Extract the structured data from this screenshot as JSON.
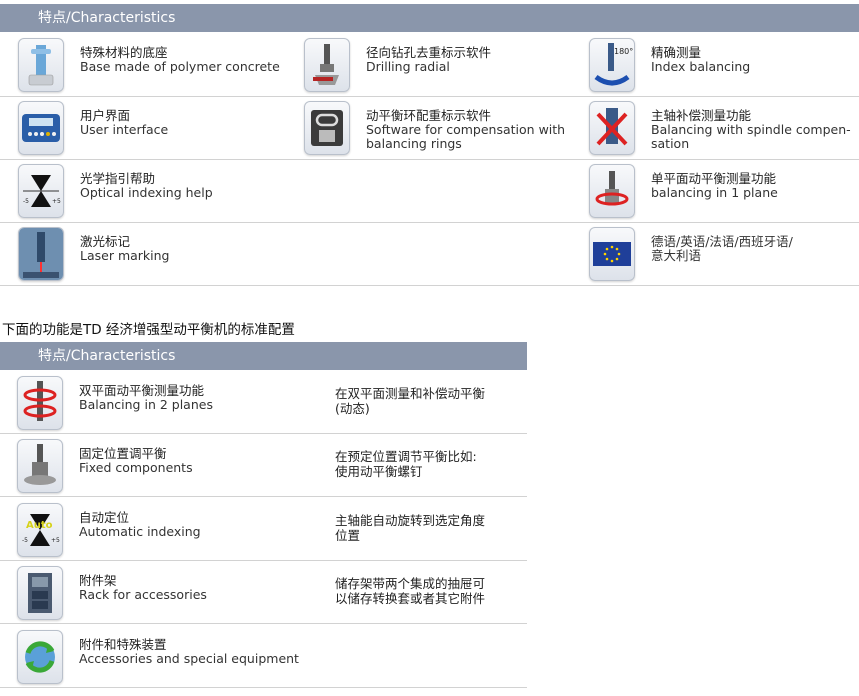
{
  "sections": [
    {
      "header": "特点/Characteristics",
      "items": [
        {
          "icon": "machine-base-icon",
          "cn": "特殊材料的底座",
          "en": [
            "Base made of polymer concrete"
          ]
        },
        {
          "icon": "drill-spindle-icon",
          "cn": "径向钻孔去重标示软件",
          "en": [
            "Drilling radial"
          ]
        },
        {
          "icon": "index-180-icon",
          "cn": "精确测量",
          "en": [
            "Index balancing"
          ]
        },
        {
          "icon": "control-panel-icon",
          "cn": "用户界面",
          "en": [
            "User interface"
          ]
        },
        {
          "icon": "balancing-ring-icon",
          "cn": "动平衡环配重标示软件",
          "en": [
            "Software for compensation with",
            "balancing rings"
          ]
        },
        {
          "icon": "spindle-crossed-icon",
          "cn": "主轴补偿测量功能",
          "en": [
            "Balancing with spindle compen-",
            "sation"
          ]
        },
        {
          "icon": "optical-index-icon",
          "cn": "光学指引帮助",
          "en": [
            "Optical indexing help"
          ]
        },
        {
          "icon": "single-plane-icon",
          "cn": "单平面动平衡测量功能",
          "en": [
            "balancing in 1 plane"
          ]
        },
        {
          "icon": "laser-marking-icon",
          "cn": "激光标记",
          "en": [
            "Laser marking"
          ]
        },
        {
          "icon": "eu-flag-icon",
          "cn": "德语/英语/法语/西班牙语/",
          "en": [
            "意大利语"
          ]
        }
      ]
    },
    {
      "title": "下面的功能是TD 经济增强型动平衡机的标准配置",
      "header": "特点/Characteristics",
      "items": [
        {
          "icon": "two-plane-icon",
          "cn": "双平面动平衡测量功能",
          "en": [
            "Balancing in 2 planes"
          ],
          "desc": [
            "在双平面测量和补偿动平衡",
            "(动态)"
          ]
        },
        {
          "icon": "fixed-component-icon",
          "cn": "固定位置调平衡",
          "en": [
            "Fixed components"
          ],
          "desc": [
            "在预定位置调节平衡比如:",
            "使用动平衡螺钉"
          ]
        },
        {
          "icon": "auto-index-icon",
          "cn": "自动定位",
          "en": [
            "Automatic indexing"
          ],
          "desc": [
            "主轴能自动旋转到选定角度",
            "位置"
          ],
          "badge": "Auto"
        },
        {
          "icon": "rack-icon",
          "cn": "附件架",
          "en": [
            "Rack for accessories"
          ],
          "desc": [
            "储存架带两个集成的抽屉可",
            "以储存转换套或者其它附件"
          ]
        },
        {
          "icon": "accessories-icon",
          "cn": "附件和特殊装置",
          "en": [
            "Accessories and special equipment"
          ],
          "desc": []
        }
      ]
    }
  ],
  "colors": {
    "header_bg": "#8a96ab",
    "header_text": "#ffffff",
    "separator": "#d2d2d2"
  }
}
